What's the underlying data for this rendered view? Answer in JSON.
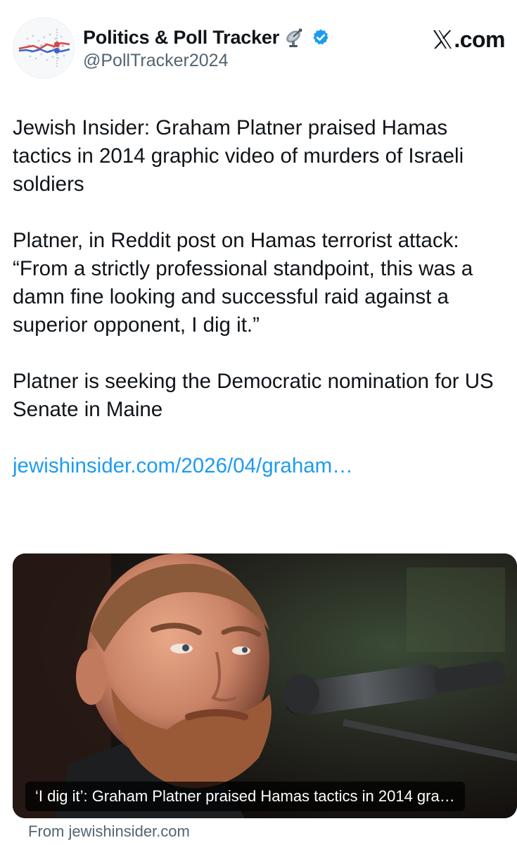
{
  "account": {
    "display_name": "Politics & Poll Tracker",
    "name_emoji": "satellite-dish-icon",
    "verified": true,
    "handle": "@PollTracker2024"
  },
  "brand": {
    "logo": "x-logo-icon",
    "suffix": ".com"
  },
  "tweet": {
    "paragraph_1": "Jewish Insider: Graham Platner praised Hamas tactics in 2014 graphic video of murders of Israeli soldiers",
    "paragraph_2": "Platner, in Reddit post on Hamas terrorist attack: “From a strictly professional standpoint, this was a damn fine looking and successful raid against a superior opponent, I dig it.”",
    "paragraph_3": "Platner is seeking the Democratic nomination for US Senate in Maine",
    "link_text": "jewishinsider.com/2026/04/graham…"
  },
  "card": {
    "title": "‘I dig it’: Graham Platner praised Hamas tactics in 2014 gra…",
    "source": "From jewishinsider.com"
  },
  "colors": {
    "link": "#1d9bf0",
    "secondary_text": "#536471",
    "verified_badge": "#1d9bf0",
    "text": "#0f1419"
  }
}
